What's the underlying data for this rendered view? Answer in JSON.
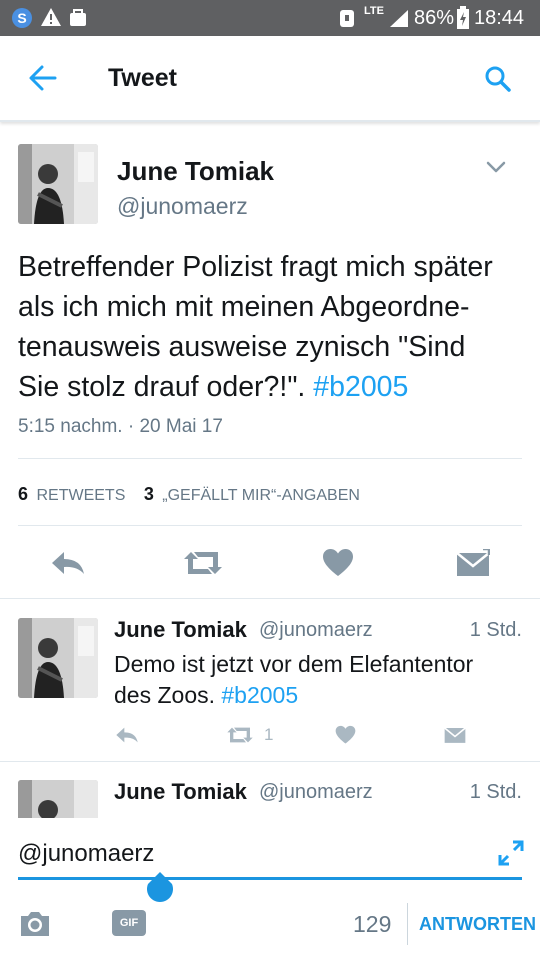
{
  "status_bar": {
    "network": "LTE",
    "battery": "86%",
    "time": "18:44"
  },
  "header": {
    "title": "Tweet"
  },
  "main_tweet": {
    "name": "June Tomiak",
    "handle": "@junomaerz",
    "text_lines": [
      "Betreffender Polizist fragt mich später",
      "als ich mich mit meinen Abgeordne-",
      "tenausweis ausweise zynisch \"Sind",
      "Sie stolz drauf oder?!\". "
    ],
    "hashtag": "#b2005",
    "timestamp": "5:15 nachm. · 20 Mai 17",
    "retweets_count": "6",
    "retweets_label": "RETWEETS",
    "likes_count": "3",
    "likes_label": "„GEFÄLLT MIR“-ANGABEN"
  },
  "replies": [
    {
      "name": "June Tomiak",
      "handle": "@junomaerz",
      "time": "1 Std.",
      "text_line1": "Demo ist jetzt vor dem Elefantentor",
      "text_line2_prefix": "des Zoos. ",
      "hashtag": "#b2005",
      "retweet_count": "1"
    },
    {
      "name": "June Tomiak",
      "handle": "@junomaerz",
      "time": "1 Std."
    }
  ],
  "compose": {
    "value": "@junomaerz",
    "gif_label": "GIF",
    "char_count": "129",
    "reply_button": "ANTWORTEN"
  },
  "colors": {
    "accent": "#1da1f2",
    "muted": "#657786",
    "icon_gray": "#8899a6",
    "status_bar": "#5f6062"
  }
}
